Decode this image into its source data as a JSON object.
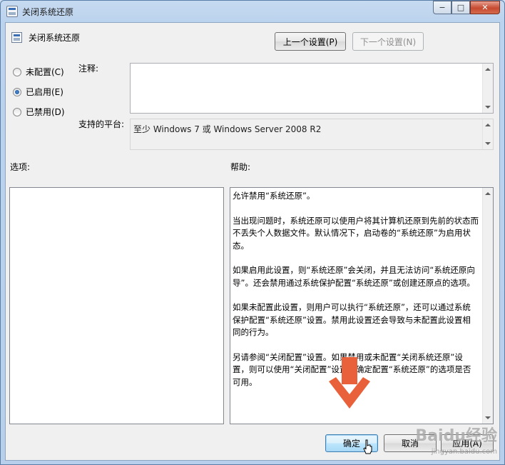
{
  "window": {
    "title": "关闭系统还原"
  },
  "header": {
    "title": "关闭系统还原"
  },
  "nav": {
    "prev_label": "上一个设置(P)",
    "next_label": "下一个设置(N)"
  },
  "state_options": [
    {
      "label": "未配置(C)",
      "checked": false
    },
    {
      "label": "已启用(E)",
      "checked": true
    },
    {
      "label": "已禁用(D)",
      "checked": false
    }
  ],
  "comment": {
    "label": "注释:",
    "value": ""
  },
  "platform": {
    "label": "支持的平台:",
    "value": "至少 Windows 7 或 Windows Server 2008 R2"
  },
  "options": {
    "label": "选项:"
  },
  "help": {
    "label": "帮助:",
    "paragraphs": [
      "允许禁用“系统还原”。",
      "当出现问题时，系统还原可以使用户将其计算机还原到先前的状态而不丢失个人数据文件。默认情况下，启动卷的“系统还原”为启用状态。",
      "如果启用此设置，则“系统还原”会关闭，并且无法访问“系统还原向导”。还会禁用通过系统保护配置“系统还原”或创建还原点的选项。",
      "如果未配置此设置，则用户可以执行“系统还原”，还可以通过系统保护配置“系统还原”设置。禁用此设置还会导致与未配置此设置相同的行为。",
      "另请参阅“关闭配置”设置。如果禁用或未配置“关闭系统还原”设置，则可以使用“关闭配置”设置来确定配置“系统还原”的选项是否可用。"
    ]
  },
  "footer": {
    "ok_label": "确定",
    "cancel_label": "取消",
    "apply_label": "应用(A)"
  },
  "colors": {
    "accent_arrow": "#e8613a",
    "title_bar": "#bcd3ee"
  },
  "watermark": {
    "text": "Baidu经验",
    "sub": "jingyan.baidu.com"
  }
}
